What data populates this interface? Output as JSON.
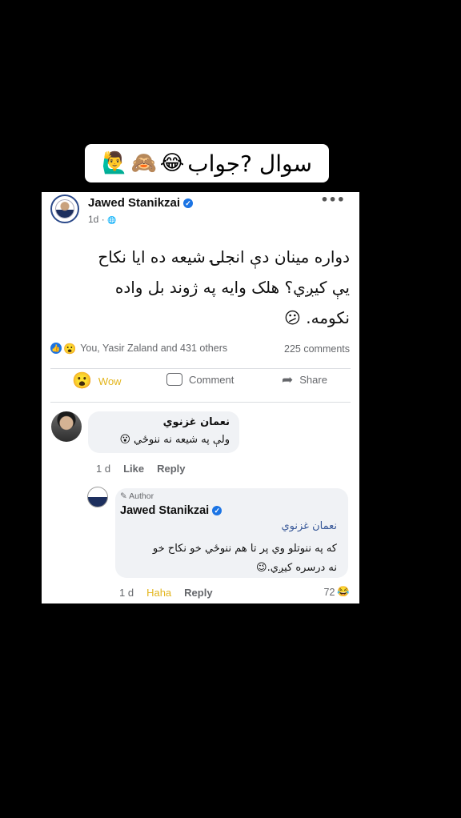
{
  "caption": {
    "text": "سوال ?جواب",
    "emojis": [
      "😂",
      "🙈",
      "🙋‍♂️"
    ]
  },
  "post": {
    "author": "Jawed Stanikzai",
    "verified_mark": "✓",
    "time": "1d",
    "separator": "·",
    "privacy_icon": "🌐",
    "more_icon": "•••",
    "text_lines": [
      "دواره مينان دې انجلۍ شيعه ده ايا نکاح",
      "يې کيږي؟ هلک وايه په ژوند بل واده",
      "نکومه."
    ],
    "text_emoji": "😕",
    "reaction_icons": [
      "👍",
      "😮"
    ],
    "reactions_text": "You, Yasir Zaland and 431 others",
    "comments_count": "225 comments",
    "actions": {
      "wow_label": "Wow",
      "wow_icon": "😮",
      "comment_label": "Comment",
      "share_label": "Share",
      "share_icon": "➦"
    }
  },
  "comment": {
    "name": "نعمان غزنوي",
    "text": "ولې په شيعه نه ننوځي",
    "emoji": "😮",
    "time": "1 d",
    "like_label": "Like",
    "reply_label": "Reply"
  },
  "reply": {
    "author_tag": "✎ Author",
    "name": "Jawed Stanikzai",
    "mention": "نعمان غزنوي",
    "text_line1": "که په ننوتلو وي پر تا هم ننوځي خو نکاح خو",
    "text_line2": "نه درسره کيږي.",
    "text_emoji": "😉",
    "time": "1 d",
    "haha_label": "Haha",
    "reply_label": "Reply",
    "reaction_count": "72",
    "reaction_emoji": "😂"
  },
  "colors": {
    "background": "#000000",
    "facebook_blue": "#1b74e4",
    "wow_yellow": "#e3b51c",
    "muted_text": "#65676b",
    "bubble_bg": "#f0f2f5"
  }
}
